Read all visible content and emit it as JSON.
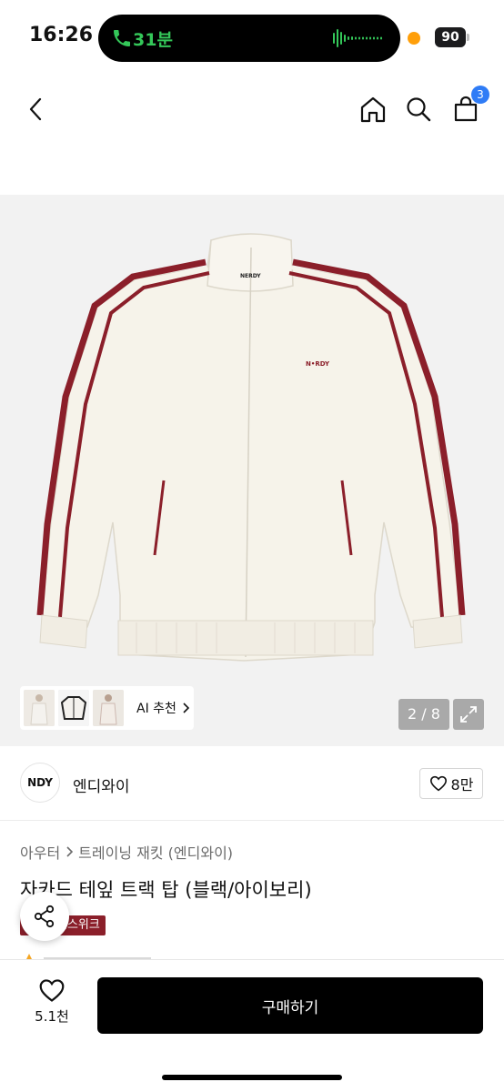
{
  "status_bar": {
    "time": "16:26",
    "call_duration": "31분",
    "battery": "90"
  },
  "header": {
    "cart_count": "3"
  },
  "gallery": {
    "ai_recommend_label": "AI 추천",
    "page_indicator": "2 / 8",
    "jacket_logo_text": "N•RDY",
    "jacket_tag_text": "NERDY",
    "colors": {
      "jacket": "#f6f3ea",
      "stripe_red": "#8b1f2a",
      "stripe_cream": "#f6f3ea",
      "background": "#f2f2f2"
    }
  },
  "brand": {
    "logo_text": "NDY",
    "name": "엔디와이",
    "likes": "8만"
  },
  "product": {
    "breadcrumb": [
      "아우터",
      "트레이닝 재킷 (엔디와이)"
    ],
    "title": "자카드 테잎 트랙 탑 (블랙/아이보리)",
    "event_badge": "언스위크"
  },
  "bottom_bar": {
    "wish_count": "5.1천",
    "buy_label": "구매하기"
  },
  "colors": {
    "accent_blue": "#2f7cf6",
    "call_green": "#34c759",
    "badge_red": "#8b1f2a",
    "buy_button": "#000000"
  }
}
